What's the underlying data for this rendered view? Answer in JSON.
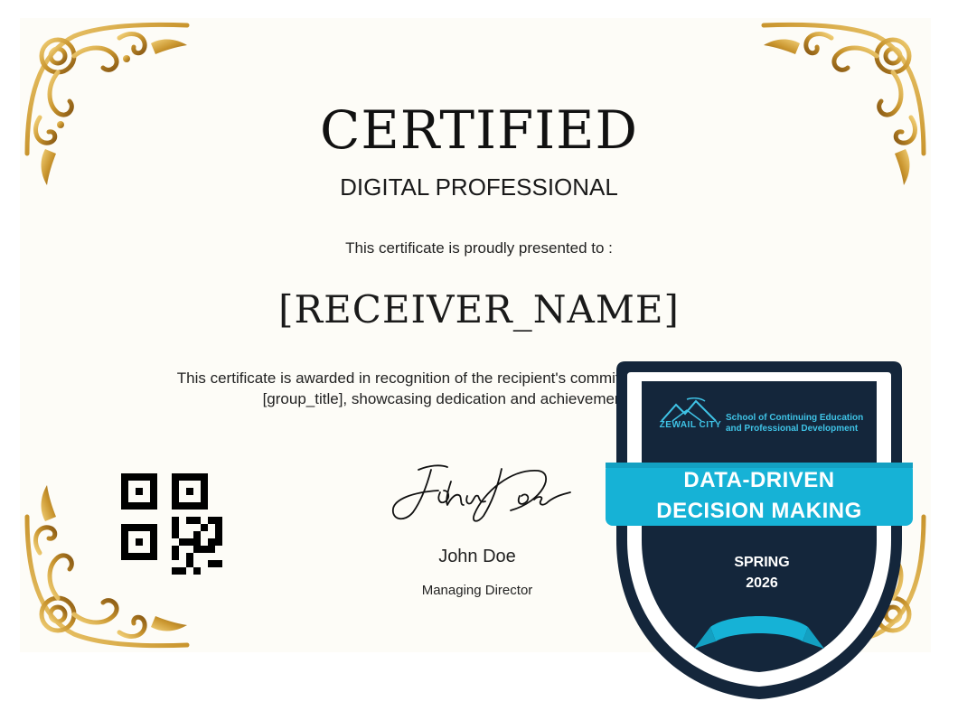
{
  "certificate": {
    "title": "CERTIFIED",
    "subtitle": "DIGITAL PROFESSIONAL",
    "presented_to": "This certificate is proudly presented to :",
    "receiver_name": "[RECEIVER_NAME]",
    "body_line1": "This certificate is awarded in recognition of the recipient's commitment to excellence as a",
    "body_line2": "[group_title], showcasing dedication and achievement. Awarded"
  },
  "signatory": {
    "signature_script": "John Doe",
    "name": "John Doe",
    "role": "Managing Director"
  },
  "badge": {
    "org_line1": "School of Continuing Education",
    "org_line2": "and Professional Development",
    "city_label": "ZEWAIL CITY",
    "title_line1": "DATA-DRIVEN",
    "title_line2": "DECISION MAKING",
    "season": "SPRING",
    "year": "2026"
  },
  "icons": {
    "corner_ornament": "gold-flourish-icon",
    "qr": "qr-code-icon",
    "badge_logo": "pyramids-logo-icon"
  },
  "colors": {
    "gold": "#c9952e",
    "badge_navy": "#14263b",
    "badge_cyan": "#16b2d6",
    "paper": "#fdfcf7"
  }
}
